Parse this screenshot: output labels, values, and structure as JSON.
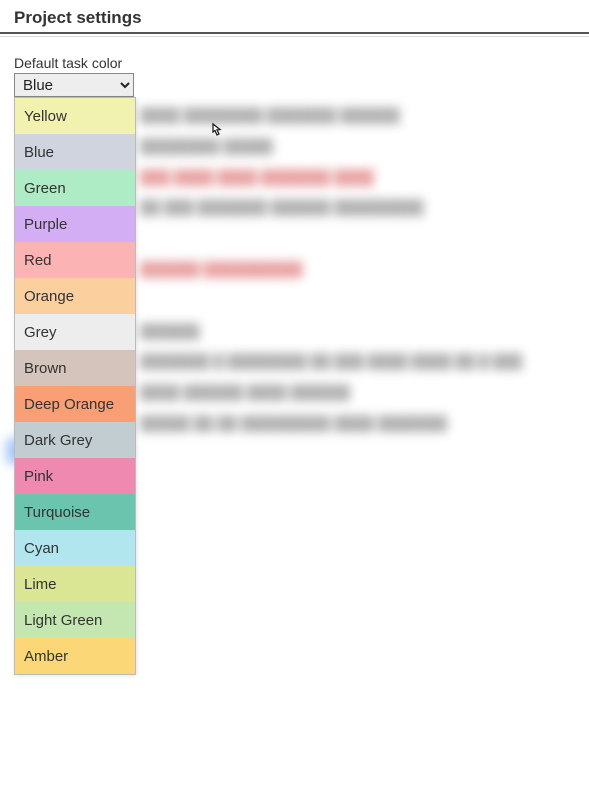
{
  "header": {
    "title": "Project settings"
  },
  "field": {
    "label": "Default task color",
    "selected": "Blue"
  },
  "options": [
    {
      "label": "Yellow",
      "bg": "#f2f2b0"
    },
    {
      "label": "Blue",
      "bg": "#cfd4df"
    },
    {
      "label": "Green",
      "bg": "#aeecc6"
    },
    {
      "label": "Purple",
      "bg": "#d4aef5"
    },
    {
      "label": "Red",
      "bg": "#fcb3b3"
    },
    {
      "label": "Orange",
      "bg": "#fccf9e"
    },
    {
      "label": "Grey",
      "bg": "#ededed"
    },
    {
      "label": "Brown",
      "bg": "#d4c4bb"
    },
    {
      "label": "Deep Orange",
      "bg": "#f89f76"
    },
    {
      "label": "Dark Grey",
      "bg": "#c2cdd2"
    },
    {
      "label": "Pink",
      "bg": "#f089b0"
    },
    {
      "label": "Turquoise",
      "bg": "#6ac4ae"
    },
    {
      "label": "Cyan",
      "bg": "#b1e6ef"
    },
    {
      "label": "Lime",
      "bg": "#dae693"
    },
    {
      "label": "Light Green",
      "bg": "#c4e6b0"
    },
    {
      "label": "Amber",
      "bg": "#fcd777"
    }
  ]
}
